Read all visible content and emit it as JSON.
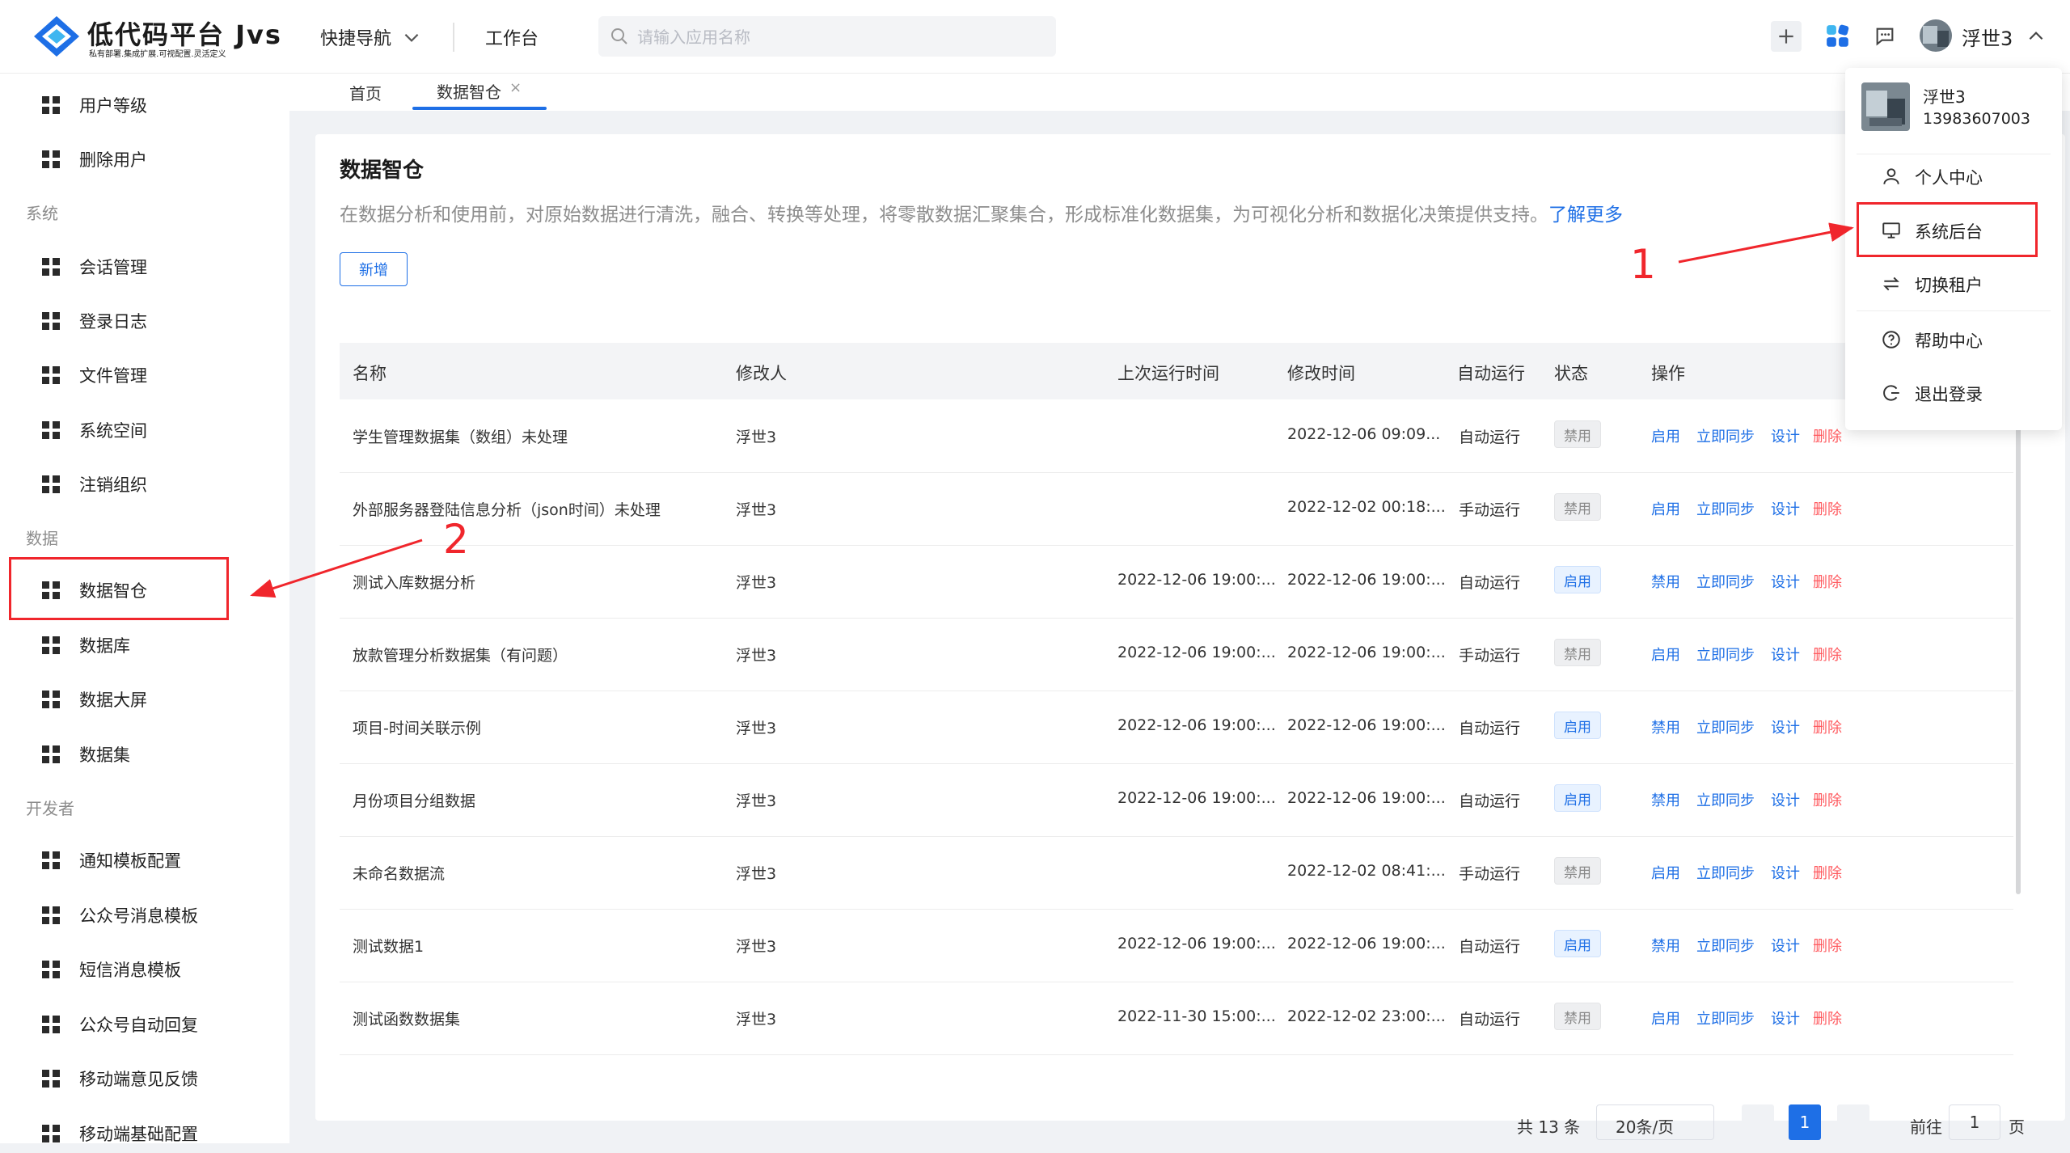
{
  "header": {
    "logo_title": "低代码平台 Jvs",
    "logo_subtitle": "私有部署.集成扩展.可视配置.灵活定义",
    "quick_nav": "快捷导航",
    "workbench": "工作台",
    "search_placeholder": "请输入应用名称",
    "user_name": "浮世3"
  },
  "sidebar": {
    "items": [
      {
        "label": "用户等级"
      },
      {
        "label": "删除用户"
      },
      {
        "section": "系统"
      },
      {
        "label": "会话管理"
      },
      {
        "label": "登录日志"
      },
      {
        "label": "文件管理"
      },
      {
        "label": "系统空间"
      },
      {
        "label": "注销组织"
      },
      {
        "section": "数据"
      },
      {
        "label": "数据智仓"
      },
      {
        "label": "数据库"
      },
      {
        "label": "数据大屏"
      },
      {
        "label": "数据集"
      },
      {
        "section": "开发者"
      },
      {
        "label": "通知模板配置"
      },
      {
        "label": "公众号消息模板"
      },
      {
        "label": "短信消息模板"
      },
      {
        "label": "公众号自动回复"
      },
      {
        "label": "移动端意见反馈"
      },
      {
        "label": "移动端基础配置"
      }
    ]
  },
  "tabs": {
    "home": "首页",
    "active": "数据智仓",
    "close": "×"
  },
  "page": {
    "title": "数据智仓",
    "description": "在数据分析和使用前，对原始数据进行清洗，融合、转换等处理，将零散数据汇聚集合，形成标准化数据集，为可视化分析和数据化决策提供支持。",
    "learn_more": "了解更多",
    "add_button": "新增"
  },
  "table": {
    "columns": [
      "名称",
      "修改人",
      "上次运行时间",
      "修改时间",
      "自动运行",
      "状态",
      "操作"
    ],
    "actions": [
      "启用",
      "立即同步",
      "设计",
      "删除"
    ],
    "actions_alt": [
      "禁用",
      "立即同步",
      "设计",
      "删除"
    ],
    "rows": [
      {
        "name": "学生管理数据集（数组）未处理",
        "modifier": "浮世3",
        "last_run": "",
        "modified": "2022-12-06 09:09...",
        "auto": "自动运行",
        "status": "禁用",
        "enabled": false
      },
      {
        "name": "外部服务器登陆信息分析（json时间）未处理",
        "modifier": "浮世3",
        "last_run": "",
        "modified": "2022-12-02 00:18:...",
        "auto": "手动运行",
        "status": "禁用",
        "enabled": false
      },
      {
        "name": "测试入库数据分析",
        "modifier": "浮世3",
        "last_run": "2022-12-06 19:00:...",
        "modified": "2022-12-06 19:00:...",
        "auto": "自动运行",
        "status": "启用",
        "enabled": true
      },
      {
        "name": "放款管理分析数据集（有问题）",
        "modifier": "浮世3",
        "last_run": "2022-12-06 19:00:...",
        "modified": "2022-12-06 19:00:...",
        "auto": "手动运行",
        "status": "禁用",
        "enabled": false
      },
      {
        "name": "项目-时间关联示例",
        "modifier": "浮世3",
        "last_run": "2022-12-06 19:00:...",
        "modified": "2022-12-06 19:00:...",
        "auto": "自动运行",
        "status": "启用",
        "enabled": true
      },
      {
        "name": "月份项目分组数据",
        "modifier": "浮世3",
        "last_run": "2022-12-06 19:00:...",
        "modified": "2022-12-06 19:00:...",
        "auto": "自动运行",
        "status": "启用",
        "enabled": true
      },
      {
        "name": "未命名数据流",
        "modifier": "浮世3",
        "last_run": "",
        "modified": "2022-12-02 08:41:...",
        "auto": "手动运行",
        "status": "禁用",
        "enabled": false
      },
      {
        "name": "测试数据1",
        "modifier": "浮世3",
        "last_run": "2022-12-06 19:00:...",
        "modified": "2022-12-06 19:00:...",
        "auto": "自动运行",
        "status": "启用",
        "enabled": true
      },
      {
        "name": "测试函数数据集",
        "modifier": "浮世3",
        "last_run": "2022-11-30 15:00:...",
        "modified": "2022-12-02 23:00:...",
        "auto": "自动运行",
        "status": "禁用",
        "enabled": false
      }
    ]
  },
  "pagination": {
    "total": "共 13 条",
    "page_size": "20条/页",
    "current_page": "1",
    "goto_label": "前往",
    "goto_value": "1",
    "page_suffix": "页"
  },
  "dropdown": {
    "name": "浮世3",
    "phone": "13983607003",
    "items": [
      {
        "label": "个人中心",
        "icon": "user-icon"
      },
      {
        "label": "系统后台",
        "icon": "monitor-icon"
      },
      {
        "label": "切换租户",
        "icon": "switch-icon"
      },
      {
        "label": "帮助中心",
        "icon": "help-icon"
      },
      {
        "label": "退出登录",
        "icon": "logout-icon"
      }
    ]
  },
  "annotations": {
    "label_1": "1",
    "label_2": "2",
    "color": "#f0262c"
  },
  "colors": {
    "accent": "#1e6fe6",
    "danger": "#ff5a5f",
    "annotation": "#f0262c"
  }
}
